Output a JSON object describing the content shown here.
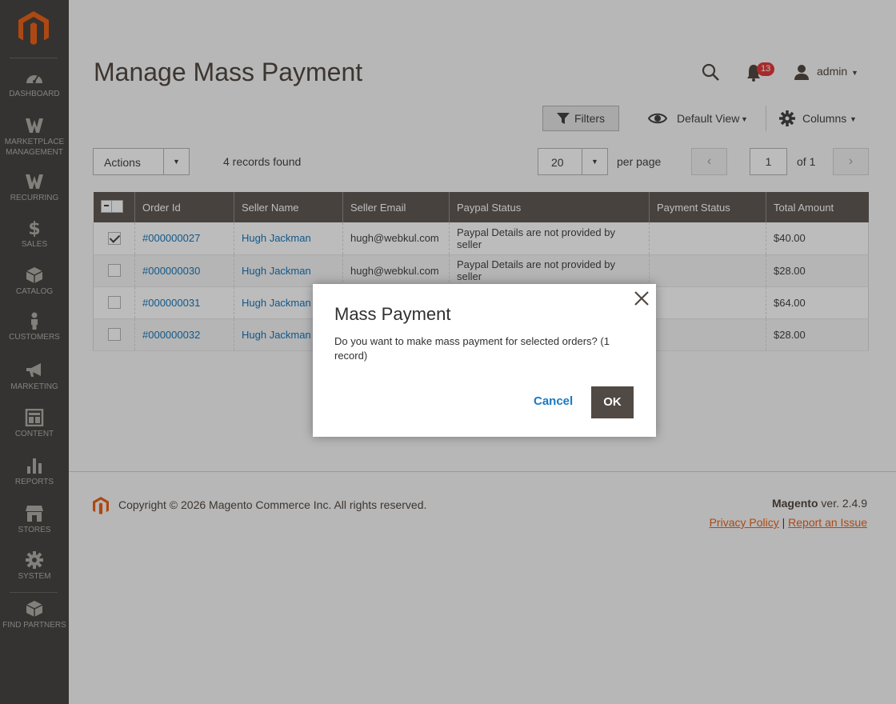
{
  "sidebar": {
    "items": [
      {
        "label": "DASHBOARD",
        "icon": "dashboard-icon"
      },
      {
        "label": "MARKETPLACE MANAGEMENT",
        "icon": "marketplace-icon"
      },
      {
        "label": "RECURRING",
        "icon": "recurring-icon"
      },
      {
        "label": "SALES",
        "icon": "dollar-icon"
      },
      {
        "label": "CATALOG",
        "icon": "box-icon"
      },
      {
        "label": "CUSTOMERS",
        "icon": "person-icon"
      },
      {
        "label": "MARKETING",
        "icon": "megaphone-icon"
      },
      {
        "label": "CONTENT",
        "icon": "layout-icon"
      },
      {
        "label": "REPORTS",
        "icon": "bar-chart-icon"
      },
      {
        "label": "STORES",
        "icon": "store-icon"
      },
      {
        "label": "SYSTEM",
        "icon": "gear-icon"
      },
      {
        "label": "FIND PARTNERS",
        "icon": "cube-icon"
      }
    ]
  },
  "header": {
    "title": "Manage Mass Payment",
    "notification_count": "13",
    "user": "admin"
  },
  "toolbar": {
    "filters_label": "Filters",
    "view_label": "Default View",
    "columns_label": "Columns",
    "actions_label": "Actions",
    "records_found": "4 records found",
    "per_page_value": "20",
    "per_page_label": "per page",
    "page_number": "1",
    "of_label": "of 1"
  },
  "grid": {
    "columns": [
      "Order Id",
      "Seller Name",
      "Seller Email",
      "Paypal Status",
      "Payment Status",
      "Total Amount"
    ],
    "rows": [
      {
        "checked": true,
        "order_id": "#000000027",
        "seller": "Hugh Jackman",
        "email": "hugh@webkul.com",
        "paypal": "Paypal Details are not provided by seller",
        "payment": "",
        "total": "$40.00"
      },
      {
        "checked": false,
        "order_id": "#000000030",
        "seller": "Hugh Jackman",
        "email": "hugh@webkul.com",
        "paypal": "Paypal Details are not provided by seller",
        "payment": "",
        "total": "$28.00"
      },
      {
        "checked": false,
        "order_id": "#000000031",
        "seller": "Hugh Jackman",
        "email": "",
        "paypal": "",
        "payment": "",
        "total": "$64.00"
      },
      {
        "checked": false,
        "order_id": "#000000032",
        "seller": "Hugh Jackman",
        "email": "",
        "paypal": "",
        "payment": "",
        "total": "$28.00"
      }
    ]
  },
  "footer": {
    "copyright": "Copyright © 2026 Magento Commerce Inc. All rights reserved.",
    "brand": "Magento",
    "version": " ver. 2.4.9",
    "privacy": "Privacy Policy",
    "separator": "|",
    "report": "Report an Issue"
  },
  "modal": {
    "title": "Mass Payment",
    "text": "Do you want to make mass payment for selected orders? (1 record)",
    "cancel": "Cancel",
    "ok": "OK"
  },
  "colors": {
    "sidebar_bg": "#373330",
    "header_bg": "#514943",
    "link": "#006bb4",
    "accent": "#eb5202"
  }
}
